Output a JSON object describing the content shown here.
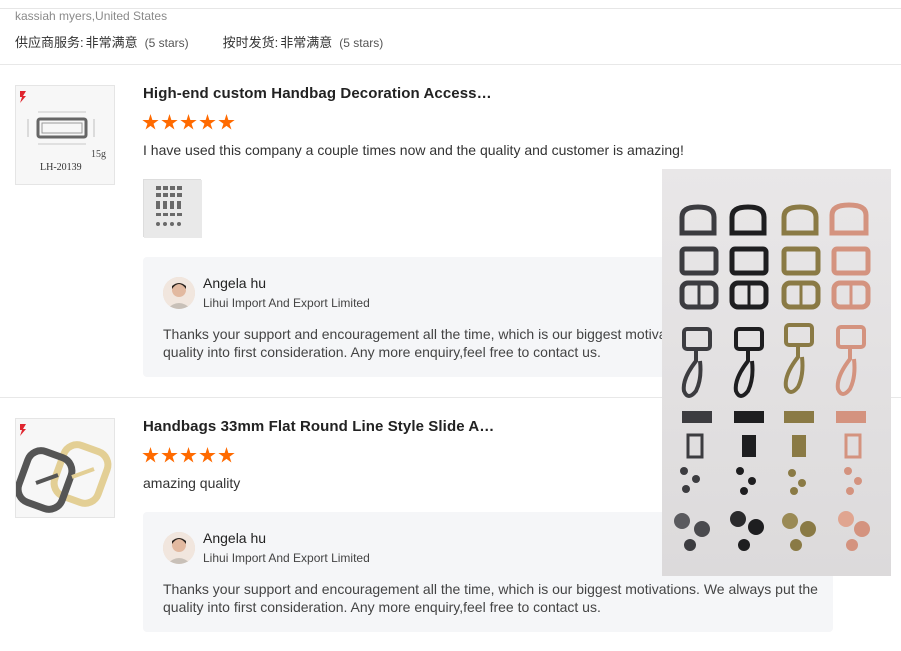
{
  "reviewer": {
    "meta": "kassiah myers,United States"
  },
  "ratings": [
    {
      "label": "供应商服务:",
      "value": "非常满意",
      "stars": "(5 stars)"
    },
    {
      "label": "按时发货:",
      "value": "非常满意",
      "stars": "(5 stars)"
    }
  ],
  "reviews": [
    {
      "title": "High-end custom Handbag Decoration Access…",
      "rating": 5,
      "comment": "I have used this company a couple times now and the quality and customer is amazing!",
      "thumb_label": "LH-20139",
      "thumb_weight": "15g",
      "reply": {
        "name": "Angela hu",
        "company": "Lihui Import And Export Limited",
        "text": "Thanks your support and encouragement all the time, which is our biggest motivations. We always put the quality into first consideration. Any more enquiry,feel free to contact us."
      }
    },
    {
      "title": "Handbags 33mm Flat Round Line Style Slide A…",
      "rating": 5,
      "comment": "amazing quality",
      "reply": {
        "name": "Angela hu",
        "company": "Lihui Import And Export Limited",
        "text": "Thanks your support and encouragement all the time, which is our biggest motivations. We always put the quality into first consideration. Any more enquiry,feel free to contact us."
      }
    }
  ],
  "colors": {
    "star": "#ff6a00",
    "reply_bg": "#f5f6f8",
    "gunmetal": "#3c3c40",
    "black": "#1e1e20",
    "bronze": "#8a7a45",
    "rosegold": "#d4937f"
  }
}
